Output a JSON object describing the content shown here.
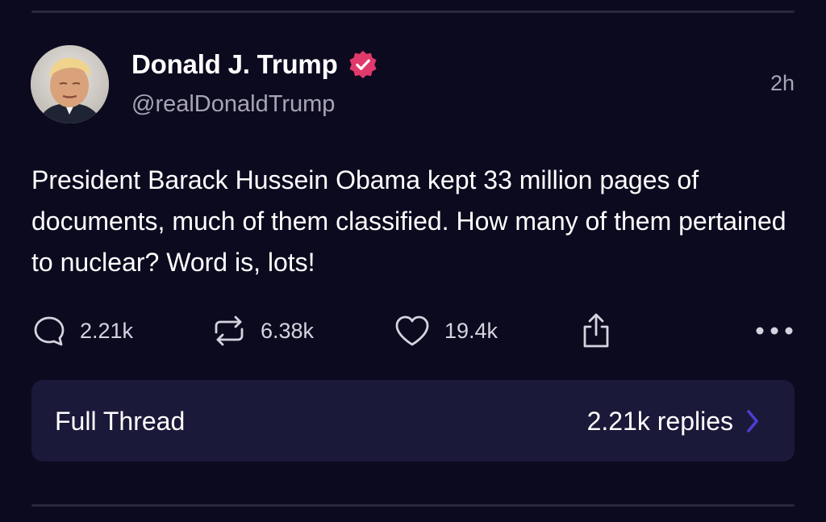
{
  "author": {
    "name": "Donald J. Trump",
    "handle": "@realDonaldTrump",
    "verified": true,
    "verified_color": "#e0396b"
  },
  "post": {
    "timestamp": "2h",
    "text": "President Barack Hussein Obama kept 33 million pages of documents, much of them classified. How many of them pertained to nuclear? Word is, lots!"
  },
  "actions": {
    "replies": "2.21k",
    "reposts": "6.38k",
    "likes": "19.4k",
    "share_icon": "share-icon",
    "more_icon": "more-icon"
  },
  "thread": {
    "label": "Full Thread",
    "replies": "2.21k replies",
    "accent": "#4b3fd1"
  },
  "colors": {
    "background": "#0c0a1f",
    "card": "#1b1939",
    "muted_text": "#a7a4b5"
  }
}
